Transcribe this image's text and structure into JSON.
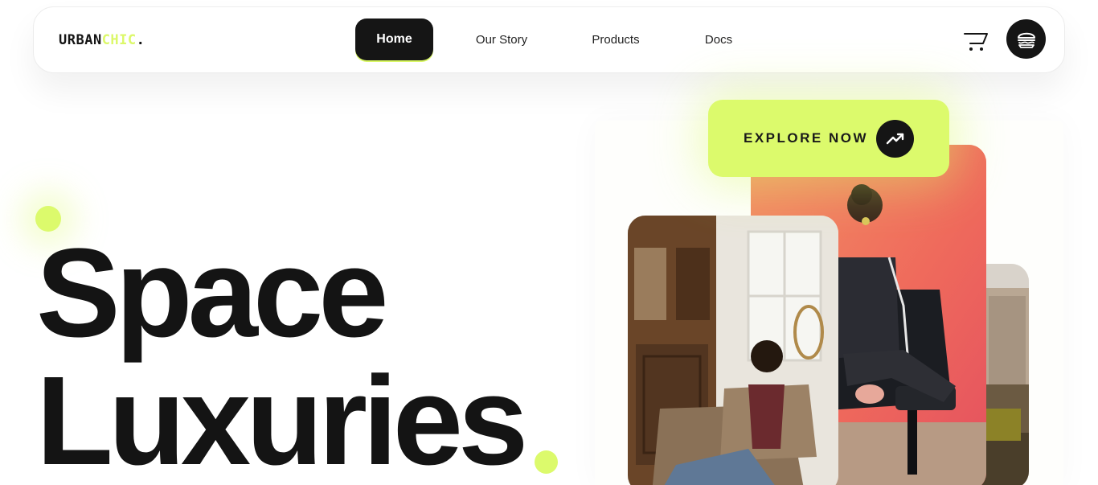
{
  "brand": {
    "part1": "URBAN",
    "part2": "CHIC",
    "part3": "."
  },
  "nav": {
    "home": "Home",
    "story": "Our Story",
    "products": "Products",
    "docs": "Docs"
  },
  "hero": {
    "line1": "Space",
    "line2": "Luxuries"
  },
  "cta": {
    "label": "EXPLORE NOW"
  },
  "colors": {
    "accent": "#dcfa6c",
    "dark": "#151515"
  },
  "icons": {
    "cart": "cart-icon",
    "menu": "burger-icon",
    "explore": "trending-up-icon"
  }
}
